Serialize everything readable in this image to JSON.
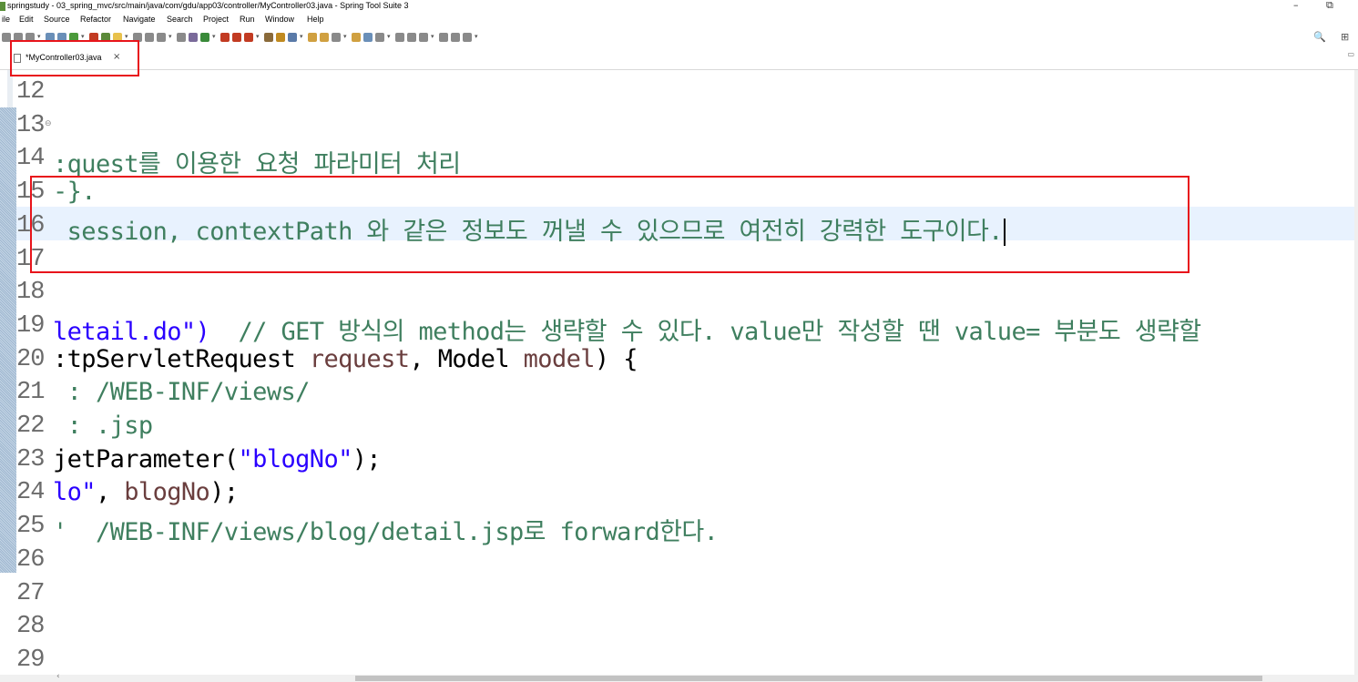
{
  "window": {
    "title": "springstudy - 03_spring_mvc/src/main/java/com/gdu/app03/controller/MyController03.java - Spring Tool Suite 3",
    "minimize": "–",
    "restore": "⧉"
  },
  "menu": {
    "items": [
      "ile",
      "Edit",
      "Source",
      "Refactor",
      "Navigate",
      "Search",
      "Project",
      "Run",
      "Window",
      "Help"
    ]
  },
  "toolbar": {
    "search_icon": "🔍",
    "perspective_icon": "⊞",
    "icon_colors": [
      "#8a8a8a",
      "#8a8a8a",
      "#8a8a8a",
      "#6a8fb8",
      "#6a8fb8",
      "#4c9a3b",
      "#c23b22",
      "#5c8a3a",
      "#e8c14c",
      "#8a8a8a",
      "#8a8a8a",
      "#8a8a8a",
      "#8a8a8a",
      "#7a6a9a",
      "#3a8a3a",
      "#c23b22",
      "#c23b22",
      "#c23b22",
      "#8a6a3a",
      "#c08a20",
      "#5a7aa8",
      "#d0a040",
      "#d0a040",
      "#8a8a8a",
      "#d0a040",
      "#6a8fb8",
      "#8a8a8a",
      "#8a8a8a",
      "#8a8a8a",
      "#8a8a8a",
      "#8a8a8a",
      "#8a8a8a",
      "#8a8a8a"
    ]
  },
  "tab": {
    "label": "*MyController03.java",
    "close": "×"
  },
  "editor": {
    "lines": [
      {
        "num": "12",
        "fold": "",
        "current": false,
        "segments": []
      },
      {
        "num": "13",
        "fold": "⊖",
        "current": false,
        "segments": []
      },
      {
        "num": "14",
        "fold": "",
        "current": false,
        "segments": [
          {
            "c": "cmt",
            "t": ":quest를 이용한 요청 파라미터 처리"
          }
        ]
      },
      {
        "num": "15",
        "fold": "",
        "current": false,
        "segments": [
          {
            "c": "cmt",
            "t": "-}."
          }
        ]
      },
      {
        "num": "16",
        "fold": "",
        "current": true,
        "caret": true,
        "segments": [
          {
            "c": "cmt",
            "t": " session, contextPath 와 같은 정보도 꺼낼 수 있으므로 여전히 강력한 도구이다."
          }
        ]
      },
      {
        "num": "17",
        "fold": "",
        "current": false,
        "segments": []
      },
      {
        "num": "18",
        "fold": "",
        "current": false,
        "segments": []
      },
      {
        "num": "19",
        "fold": "",
        "current": false,
        "segments": [
          {
            "c": "str",
            "t": "letail.do\")"
          },
          {
            "c": "plain",
            "t": "  "
          },
          {
            "c": "cmt",
            "t": "// GET 방식의 method는 생략할 수 있다. value만 작성할 땐 value= 부분도 생략할"
          }
        ]
      },
      {
        "num": "20",
        "fold": "",
        "current": false,
        "segments": [
          {
            "c": "plain",
            "t": ":tpServletRequest "
          },
          {
            "c": "var",
            "t": "request"
          },
          {
            "c": "plain",
            "t": ", Model "
          },
          {
            "c": "var",
            "t": "model"
          },
          {
            "c": "plain",
            "t": ") {"
          }
        ]
      },
      {
        "num": "21",
        "fold": "",
        "current": false,
        "segments": [
          {
            "c": "cmt",
            "t": " : /WEB-INF/views/"
          }
        ]
      },
      {
        "num": "22",
        "fold": "",
        "current": false,
        "segments": [
          {
            "c": "cmt",
            "t": " : .jsp"
          }
        ]
      },
      {
        "num": "23",
        "fold": "",
        "current": false,
        "segments": [
          {
            "c": "plain",
            "t": "jetParameter("
          },
          {
            "c": "str",
            "t": "\"blogNo\""
          },
          {
            "c": "plain",
            "t": ");"
          }
        ]
      },
      {
        "num": "24",
        "fold": "",
        "current": false,
        "segments": [
          {
            "c": "str",
            "t": "lo\""
          },
          {
            "c": "plain",
            "t": ", "
          },
          {
            "c": "var",
            "t": "blogNo"
          },
          {
            "c": "plain",
            "t": ");"
          }
        ]
      },
      {
        "num": "25",
        "fold": "",
        "current": false,
        "segments": [
          {
            "c": "cmt",
            "t": "'  /WEB-INF/views/blog/detail.jsp로 forward한다."
          }
        ]
      },
      {
        "num": "26",
        "fold": "",
        "current": false,
        "segments": []
      },
      {
        "num": "27",
        "fold": "",
        "current": false,
        "segments": []
      },
      {
        "num": "28",
        "fold": "",
        "current": false,
        "segments": []
      },
      {
        "num": "29",
        "fold": "",
        "current": false,
        "segments": []
      }
    ]
  },
  "annotation_color": "#e8141b"
}
